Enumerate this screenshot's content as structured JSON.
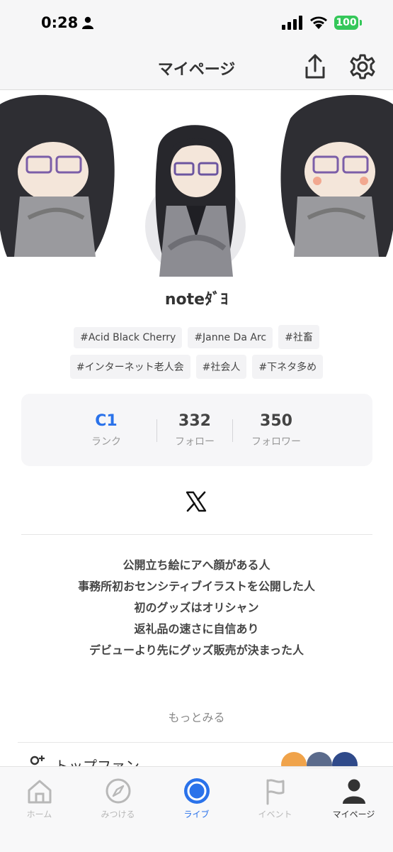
{
  "status_bar": {
    "time": "0:28",
    "battery": "100"
  },
  "header": {
    "title": "マイページ",
    "share_icon": "share-icon",
    "settings_icon": "gear-icon"
  },
  "profile": {
    "username": "noteﾀﾞﾖ",
    "tags": [
      [
        "#Acid Black Cherry",
        "#Janne Da Arc",
        "#社畜"
      ],
      [
        "#インターネット老人会",
        "#社会人",
        "#下ネタ多め"
      ]
    ]
  },
  "stats": [
    {
      "value": "C1",
      "label": "ランク"
    },
    {
      "value": "332",
      "label": "フォロー"
    },
    {
      "value": "350",
      "label": "フォロワー"
    }
  ],
  "social": {
    "icon": "x-icon"
  },
  "bio": [
    "公開立ち絵にアへ顔がある人",
    "事務所初おセンシティブイラストを公開した人",
    "初のグッズはオリシャン",
    "返礼品の速さに自信あり",
    "デビューより先にグッズ販売が決まった人"
  ],
  "more_label": "もっとみる",
  "top_fan": {
    "label": "トップファン"
  },
  "tabbar": [
    {
      "label": "ホーム",
      "icon": "home-icon"
    },
    {
      "label": "みつける",
      "icon": "compass-icon"
    },
    {
      "label": "ライブ",
      "icon": "live-icon"
    },
    {
      "label": "イベント",
      "icon": "flag-icon"
    },
    {
      "label": "マイページ",
      "icon": "person-icon"
    }
  ],
  "colors": {
    "accent": "#2a72ea",
    "battery": "#34c759",
    "text": "#333333"
  }
}
